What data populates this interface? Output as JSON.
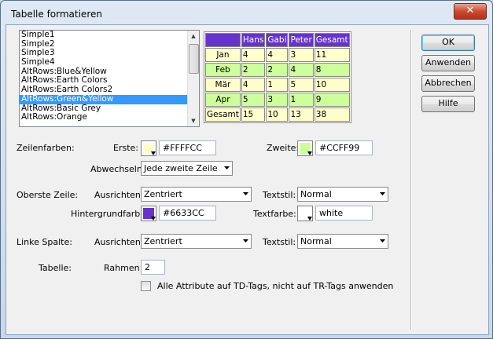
{
  "window": {
    "title": "Tabelle formatieren",
    "close_glyph": "✕"
  },
  "styles_list": {
    "items": [
      "Simple1",
      "Simple2",
      "Simple3",
      "Simple4",
      "AltRows:Blue&Yellow",
      "AltRows:Earth Colors",
      "AltRows:Earth Colors2",
      "AltRows:Green&Yellow",
      "AltRows:Basic Grey",
      "AltRows:Orange"
    ],
    "selected_index": 7,
    "scroll_up_glyph": "▲",
    "scroll_down_glyph": "▼"
  },
  "preview": {
    "header": [
      "",
      "Hans",
      "Gabi",
      "Peter",
      "Gesamt"
    ],
    "rows": [
      [
        "Jan",
        "4",
        "4",
        "3",
        "11"
      ],
      [
        "Feb",
        "2",
        "2",
        "4",
        "8"
      ],
      [
        "Mär",
        "4",
        "1",
        "5",
        "10"
      ],
      [
        "Apr",
        "5",
        "3",
        "1",
        "9"
      ],
      [
        "Gesamt",
        "15",
        "10",
        "13",
        "38"
      ]
    ],
    "colors": {
      "header_bg": "#6633CC",
      "row_first": "#FFFFCC",
      "row_second": "#CCFF99"
    }
  },
  "buttons": {
    "ok": "OK",
    "apply": "Anwenden",
    "cancel": "Abbrechen",
    "help": "Hilfe"
  },
  "row_colors": {
    "section_label": "Zeilenfarben:",
    "first_label": "Erste:",
    "first_value": "#FFFFCC",
    "first_color": "#FFFFCC",
    "second_label": "Zweite:",
    "second_value": "#CCFF99",
    "second_color": "#CCFF99",
    "alternate_label": "Abwechseln:",
    "alternate_value": "Jede zweite Zeile"
  },
  "top_row": {
    "section_label": "Oberste Zeile:",
    "align_label": "Ausrichten:",
    "align_value": "Zentriert",
    "textstyle_label": "Textstil:",
    "textstyle_value": "Normal",
    "bg_label": "Hintergrundfarbe:",
    "bg_value": "#6633CC",
    "bg_color": "#6633CC",
    "textcolor_label": "Textfarbe:",
    "textcolor_value": "white",
    "textcolor_color": "#FFFFFF"
  },
  "left_column": {
    "section_label": "Linke Spalte:",
    "align_label": "Ausrichten:",
    "align_value": "Zentriert",
    "textstyle_label": "Textstil:",
    "textstyle_value": "Normal"
  },
  "table": {
    "section_label": "Tabelle:",
    "border_label": "Rahmen:",
    "border_value": "2",
    "apply_td_label": "Alle Attribute auf TD-Tags, nicht auf TR-Tags anwenden",
    "apply_td_checked": false
  }
}
